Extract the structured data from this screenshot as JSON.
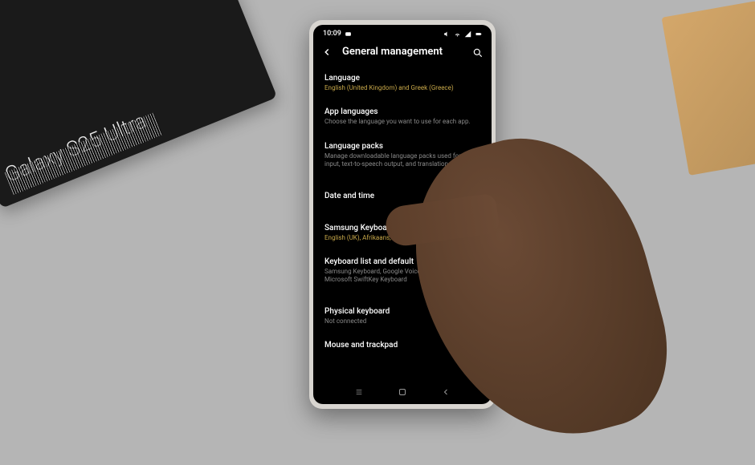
{
  "box": {
    "product_name": "Galaxy S25 Ultra"
  },
  "status_bar": {
    "time": "10:09"
  },
  "header": {
    "title": "General management"
  },
  "settings": {
    "language": {
      "title": "Language",
      "desc": "English (United Kingdom) and Greek (Greece)"
    },
    "app_languages": {
      "title": "App languages",
      "desc": "Choose the language you want to use for each app."
    },
    "language_packs": {
      "title": "Language packs",
      "desc": "Manage downloadable language packs used for voice input, text-to-speech output, and translation."
    },
    "date_time": {
      "title": "Date and time"
    },
    "keyboard_settings": {
      "title": "Samsung Keyboard settings",
      "desc": "English (UK), Afrikaans, Azərbaycan and العربية"
    },
    "keyboard_list": {
      "title": "Keyboard list and default",
      "desc": "Samsung Keyboard, Google Voice Typing and Microsoft SwiftKey Keyboard"
    },
    "physical_keyboard": {
      "title": "Physical keyboard",
      "desc": "Not connected"
    },
    "mouse_trackpad": {
      "title": "Mouse and trackpad"
    }
  }
}
